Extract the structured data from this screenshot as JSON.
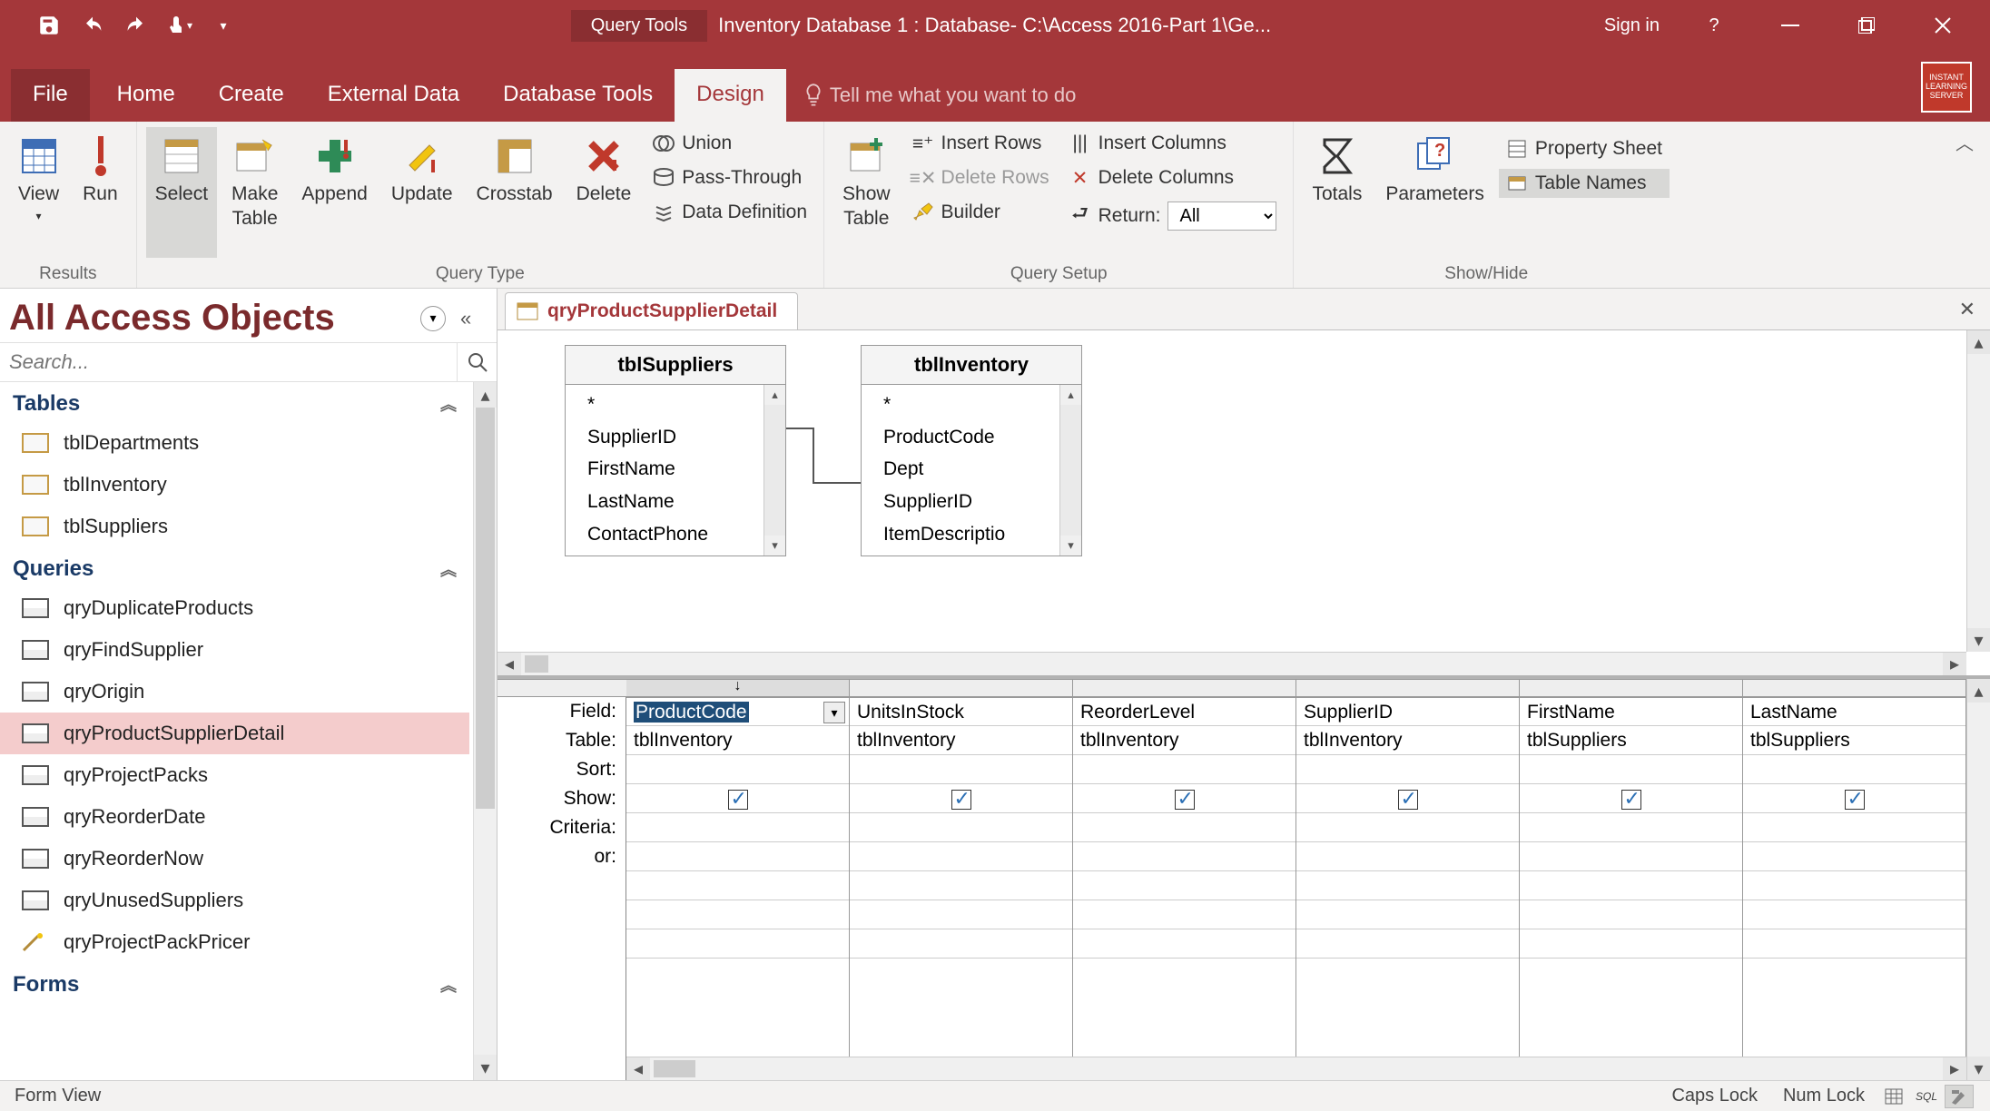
{
  "titlebar": {
    "context_tab": "Query Tools",
    "app_title": "Inventory Database 1 : Database- C:\\Access 2016-Part 1\\Ge...",
    "signin": "Sign in"
  },
  "tabs": {
    "file": "File",
    "home": "Home",
    "create": "Create",
    "external": "External Data",
    "dbtools": "Database Tools",
    "design": "Design",
    "tellme_placeholder": "Tell me what you want to do"
  },
  "ribbon": {
    "groups": {
      "results": "Results",
      "querytype": "Query Type",
      "querysetup": "Query Setup",
      "showhide": "Show/Hide"
    },
    "results": {
      "view": "View",
      "run": "Run"
    },
    "qtype": {
      "select": "Select",
      "maketable": "Make\nTable",
      "append": "Append",
      "update": "Update",
      "crosstab": "Crosstab",
      "delete": "Delete",
      "union": "Union",
      "passthrough": "Pass-Through",
      "datadef": "Data Definition"
    },
    "setup": {
      "showtable": "Show\nTable",
      "insertrows": "Insert Rows",
      "deleterows": "Delete Rows",
      "builder": "Builder",
      "insertcols": "Insert Columns",
      "deletecols": "Delete Columns",
      "return": "Return:",
      "return_val": "All"
    },
    "showhide": {
      "totals": "Totals",
      "parameters": "Parameters",
      "propsheet": "Property Sheet",
      "tablenames": "Table Names"
    }
  },
  "nav": {
    "title": "All Access Objects",
    "search_placeholder": "Search...",
    "groups": {
      "tables": {
        "label": "Tables",
        "items": [
          "tblDepartments",
          "tblInventory",
          "tblSuppliers"
        ]
      },
      "queries": {
        "label": "Queries",
        "items": [
          "qryDuplicateProducts",
          "qryFindSupplier",
          "qryOrigin",
          "qryProductSupplierDetail",
          "qryProjectPacks",
          "qryReorderDate",
          "qryReorderNow",
          "qryUnusedSuppliers",
          "qryProjectPackPricer"
        ],
        "selected": "qryProductSupplierDetail"
      },
      "forms": {
        "label": "Forms"
      }
    }
  },
  "doc": {
    "tab": "qryProductSupplierDetail"
  },
  "design_tables": {
    "suppliers": {
      "title": "tblSuppliers",
      "fields": [
        "*",
        "SupplierID",
        "FirstName",
        "LastName",
        "ContactPhone"
      ],
      "pk": "SupplierID"
    },
    "inventory": {
      "title": "tblInventory",
      "fields": [
        "*",
        "ProductCode",
        "Dept",
        "SupplierID",
        "ItemDescriptio"
      ],
      "pk": "ProductCode"
    }
  },
  "qbe": {
    "rows": {
      "field": "Field:",
      "table": "Table:",
      "sort": "Sort:",
      "show": "Show:",
      "criteria": "Criteria:",
      "or": "or:"
    },
    "cols": [
      {
        "field": "ProductCode",
        "table": "tblInventory",
        "show": true,
        "active": true
      },
      {
        "field": "UnitsInStock",
        "table": "tblInventory",
        "show": true
      },
      {
        "field": "ReorderLevel",
        "table": "tblInventory",
        "show": true
      },
      {
        "field": "SupplierID",
        "table": "tblInventory",
        "show": true
      },
      {
        "field": "FirstName",
        "table": "tblSuppliers",
        "show": true
      },
      {
        "field": "LastName",
        "table": "tblSuppliers",
        "show": true
      }
    ]
  },
  "status": {
    "left": "Form View",
    "caps": "Caps Lock",
    "num": "Num Lock"
  }
}
